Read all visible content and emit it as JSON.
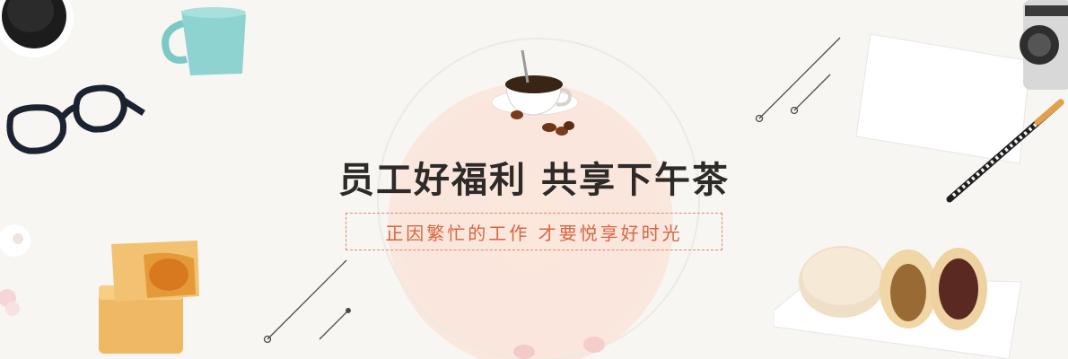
{
  "banner": {
    "headline": "员工好福利  共享下午茶",
    "tagline": "正因繁忙的工作  才要悦享好时光"
  },
  "colors": {
    "background": "#f8f6f2",
    "headline": "#2d2a28",
    "tagline": "#d8653f",
    "tagline_border": "#d98a6e",
    "glow": "#fbe7dc"
  },
  "decorations": [
    "coffee-cup-icon",
    "mug-icon",
    "glasses-icon",
    "notepad-icon",
    "camera-icon",
    "pen-icon",
    "pastry-icon",
    "mooncakes-icon",
    "flower-icon",
    "petal-icon"
  ]
}
